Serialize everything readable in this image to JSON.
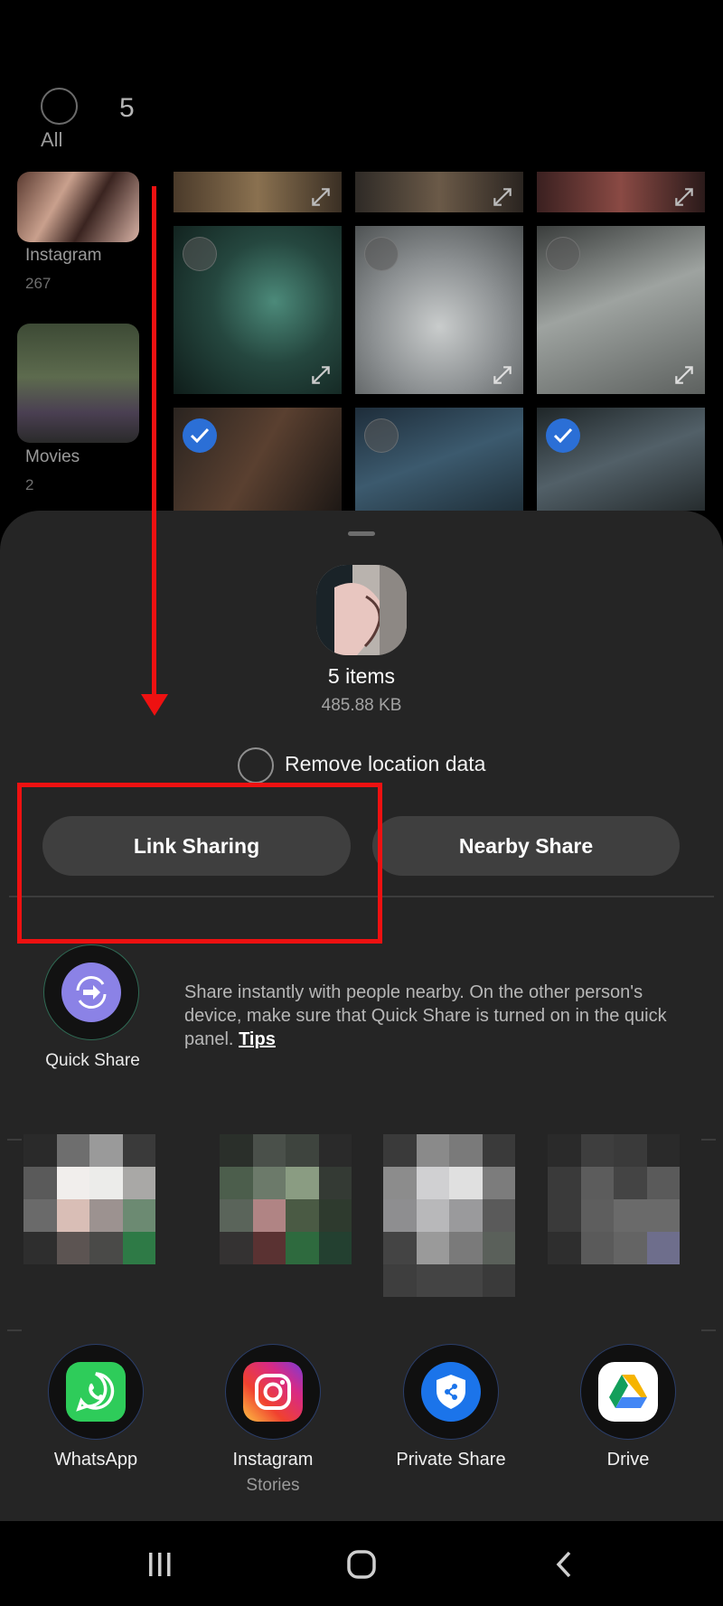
{
  "gallery": {
    "select_all_label": "All",
    "selected_count": "5",
    "albums": [
      {
        "name": "Instagram",
        "count": "267"
      },
      {
        "name": "Movies",
        "count": "2"
      }
    ]
  },
  "share_sheet": {
    "items_title": "5 items",
    "items_size": "485.88 KB",
    "remove_location_label": "Remove location data",
    "link_sharing_label": "Link Sharing",
    "nearby_share_label": "Nearby Share",
    "quick_share": {
      "label": "Quick Share",
      "description": "Share instantly with people nearby. On the other person's device, make sure that Quick Share is turned on in the quick panel.",
      "tips_link": "Tips"
    },
    "apps": [
      {
        "label": "WhatsApp",
        "sublabel": "",
        "icon": "whatsapp-icon"
      },
      {
        "label": "Instagram",
        "sublabel": "Stories",
        "icon": "instagram-icon"
      },
      {
        "label": "Private Share",
        "sublabel": "",
        "icon": "private-share-icon"
      },
      {
        "label": "Drive",
        "sublabel": "",
        "icon": "drive-icon"
      }
    ]
  },
  "navbar": {
    "icons": [
      "recents-icon",
      "home-icon",
      "back-icon"
    ]
  },
  "colors": {
    "sheet_bg": "#252525",
    "pill_bg": "#3f3f3f",
    "annotation": "#ee1111",
    "check_blue": "#2b6fd6"
  }
}
